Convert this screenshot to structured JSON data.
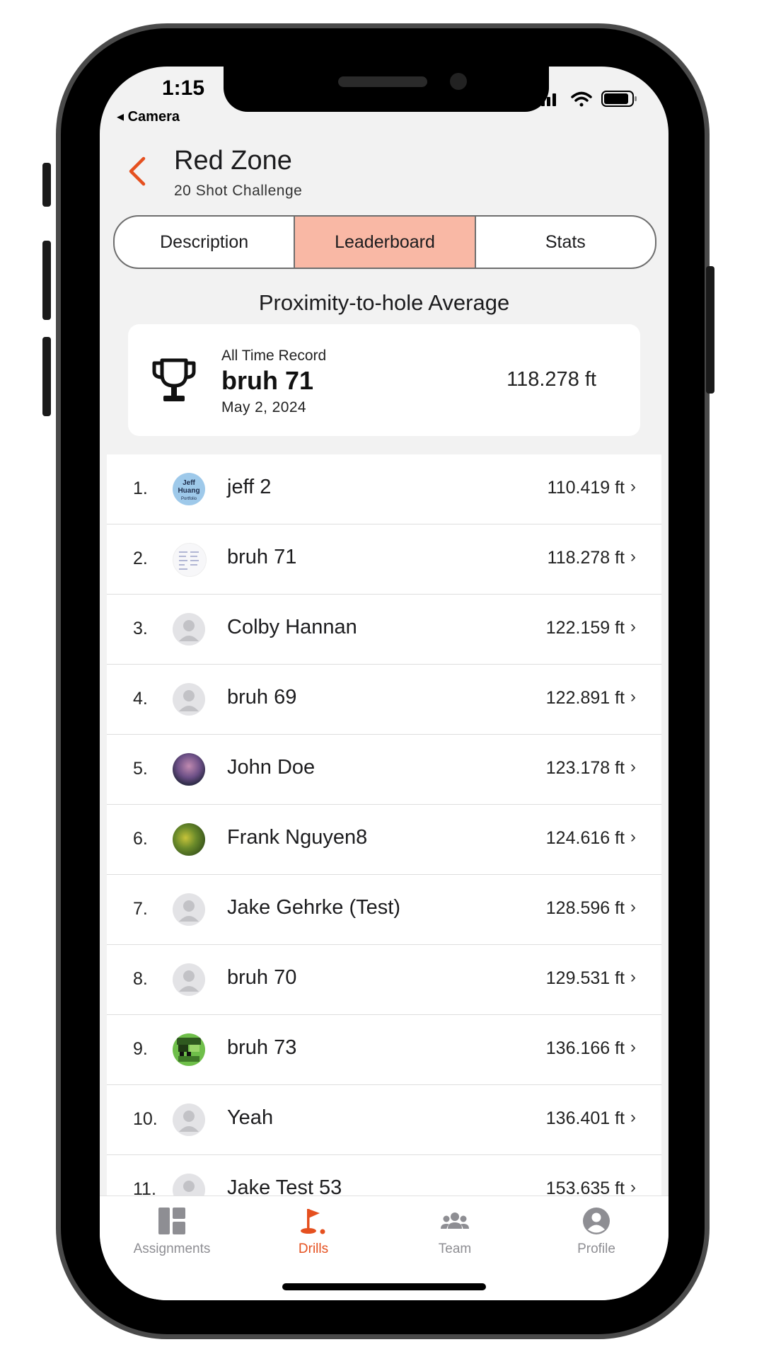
{
  "status_bar": {
    "time": "1:15",
    "back_app": "◂ Camera"
  },
  "header": {
    "title": "Red Zone",
    "subtitle": "20 Shot Challenge"
  },
  "tabs": [
    {
      "label": "Description",
      "active": false
    },
    {
      "label": "Leaderboard",
      "active": true
    },
    {
      "label": "Stats",
      "active": false
    }
  ],
  "section_title": "Proximity-to-hole Average",
  "record": {
    "label": "All Time Record",
    "name": "bruh 71",
    "date": "May 2, 2024",
    "value": "118.278 ft"
  },
  "leaderboard": [
    {
      "rank": "1.",
      "name": "jeff 2",
      "value": "110.419 ft",
      "avatar": "jeff-huang-portfolio"
    },
    {
      "rank": "2.",
      "name": "bruh 71",
      "value": "118.278 ft",
      "avatar": "document-thumbnail"
    },
    {
      "rank": "3.",
      "name": "Colby Hannan",
      "value": "122.159 ft",
      "avatar": "default-person"
    },
    {
      "rank": "4.",
      "name": "bruh 69",
      "value": "122.891 ft",
      "avatar": "default-person"
    },
    {
      "rank": "5.",
      "name": "John Doe",
      "value": "123.178 ft",
      "avatar": "purple-sky-photo"
    },
    {
      "rank": "6.",
      "name": "Frank Nguyen8",
      "value": "124.616 ft",
      "avatar": "green-leaves-photo"
    },
    {
      "rank": "7.",
      "name": "Jake Gehrke (Test)",
      "value": "128.596 ft",
      "avatar": "default-person"
    },
    {
      "rank": "8.",
      "name": "bruh 70",
      "value": "129.531 ft",
      "avatar": "default-person"
    },
    {
      "rank": "9.",
      "name": "bruh 73",
      "value": "136.166 ft",
      "avatar": "pixel-art"
    },
    {
      "rank": "10.",
      "name": "Yeah",
      "value": "136.401 ft",
      "avatar": "default-person"
    },
    {
      "rank": "11.",
      "name": "Jake Test 53",
      "value": "153.635 ft",
      "avatar": "default-person"
    }
  ],
  "avatar_text": {
    "jeff": "Jeff",
    "huang": "Huang",
    "portfolio": "Portfolio"
  },
  "chevron": "›",
  "tab_bar": [
    {
      "label": "Assignments",
      "icon": "dashboard-icon",
      "active": false
    },
    {
      "label": "Drills",
      "icon": "golf-flag-icon",
      "active": true
    },
    {
      "label": "Team",
      "icon": "team-icon",
      "active": false
    },
    {
      "label": "Profile",
      "icon": "profile-icon",
      "active": false
    }
  ],
  "colors": {
    "accent": "#e5501f",
    "active_tab_bg": "#f9b8a5",
    "inactive": "#8e8e93"
  }
}
